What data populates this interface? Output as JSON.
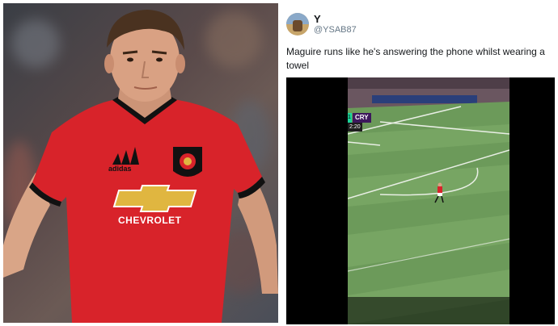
{
  "photo": {
    "jersey_sponsor": "CHEVROLET",
    "kit_brand": "adidas",
    "colors": {
      "jersey": "#d8232a",
      "trim": "#111111",
      "sponsor_logo": "#e0b640"
    }
  },
  "tweet": {
    "display_name": "Y",
    "handle": "@YSAB87",
    "text": "Maguire runs like he's answering the phone whilst wearing a towel",
    "video": {
      "score_home": "1",
      "score_team": "CRY",
      "clock": "2:20",
      "colors": {
        "pitch": "#6c9a5a",
        "scoreboard": "#3d185c",
        "accent": "#1bd49a"
      }
    }
  }
}
